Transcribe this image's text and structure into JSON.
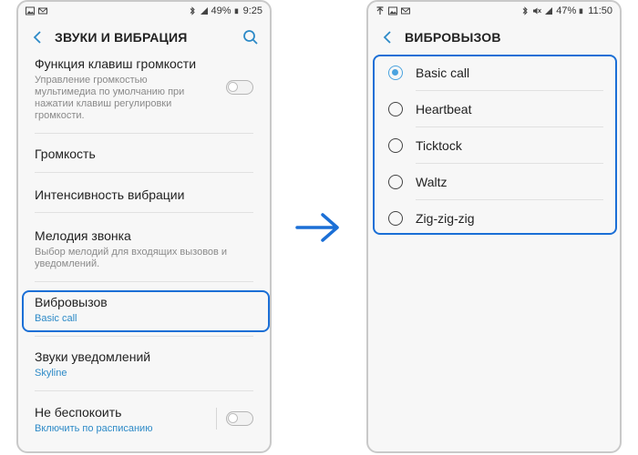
{
  "left_screen": {
    "status": {
      "battery": "49%",
      "time": "9:25"
    },
    "header": {
      "title": "ЗВУКИ И ВИБРАЦИЯ"
    },
    "items": [
      {
        "title": "Функция клавиш громкости",
        "desc": "Управление громкостью мультимедиа по умолчанию при нажатии клавиш регулировки громкости."
      },
      {
        "title": "Громкость"
      },
      {
        "title": "Интенсивность вибрации"
      },
      {
        "title": "Мелодия звонка",
        "desc": "Выбор мелодий для входящих вызовов и уведомлений."
      },
      {
        "title": "Вибровызов",
        "sub": "Basic call"
      },
      {
        "title": "Звуки уведомлений",
        "sub": "Skyline"
      },
      {
        "title": "Не беспокоить",
        "sub": "Включить по расписанию"
      }
    ]
  },
  "right_screen": {
    "status": {
      "battery": "47%",
      "time": "11:50"
    },
    "header": {
      "title": "ВИБРОВЫЗОВ"
    },
    "options": [
      {
        "label": "Basic call",
        "selected": true
      },
      {
        "label": "Heartbeat",
        "selected": false
      },
      {
        "label": "Ticktock",
        "selected": false
      },
      {
        "label": "Waltz",
        "selected": false
      },
      {
        "label": "Zig-zig-zig",
        "selected": false
      }
    ]
  },
  "colors": {
    "highlight": "#1b6fd6",
    "accent": "#4aa3df",
    "link": "#2d8ac7"
  }
}
